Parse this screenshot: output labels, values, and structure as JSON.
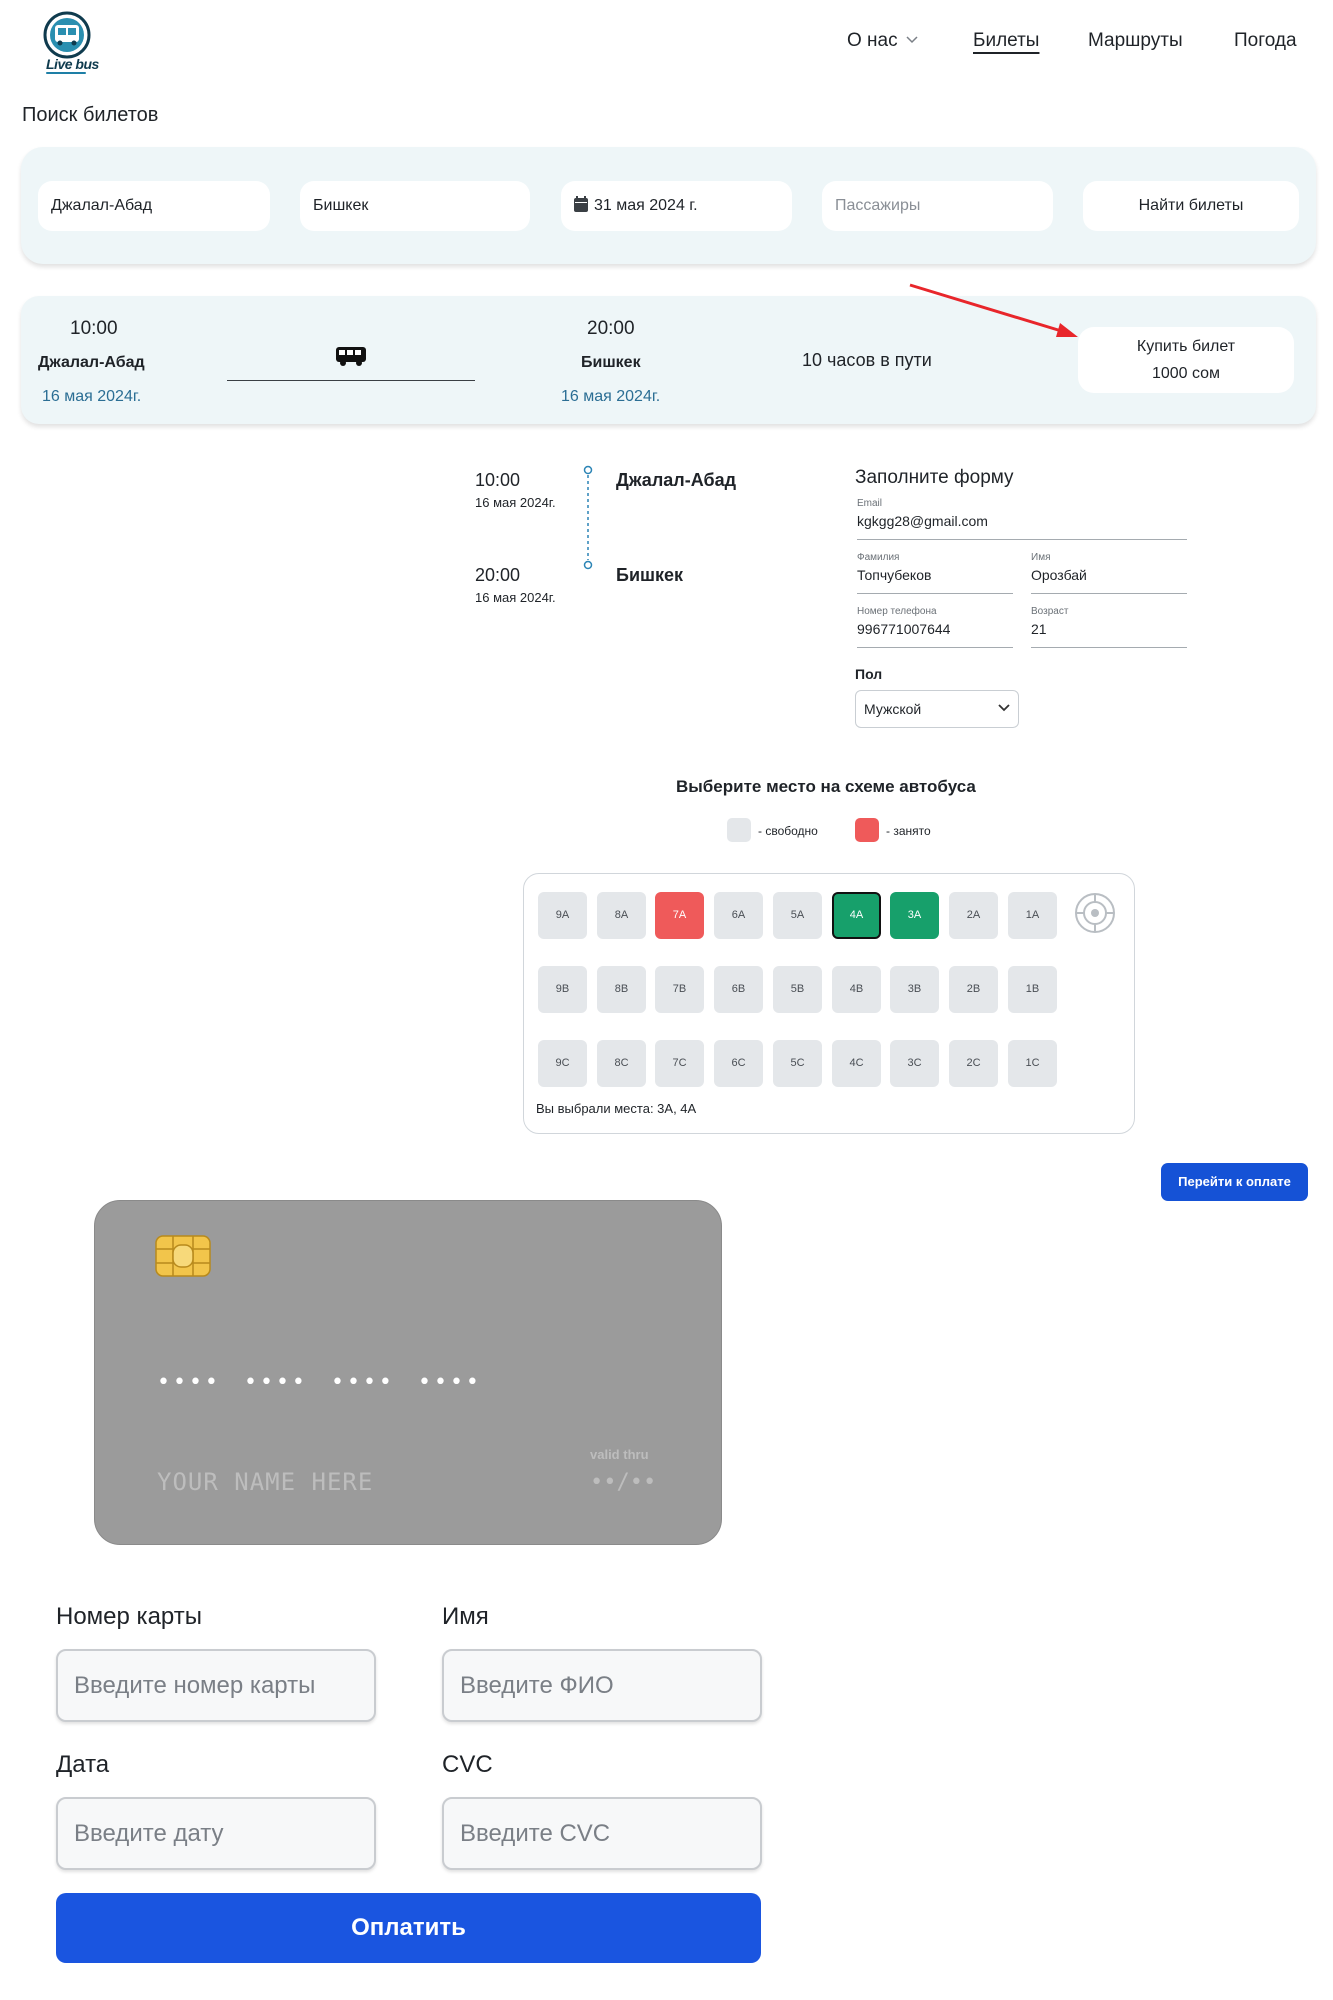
{
  "header": {
    "logo_text": "Live bus",
    "nav": [
      {
        "label": "О нас"
      },
      {
        "label": "Билеты"
      },
      {
        "label": "Маршруты"
      },
      {
        "label": "Погода"
      }
    ]
  },
  "page_title": "Поиск билетов",
  "search": {
    "from": "Джалал-Абад",
    "to": "Бишкек",
    "date": "31 мая 2024 г.",
    "passengers_placeholder": "Пассажиры",
    "button": "Найти билеты"
  },
  "result": {
    "depart_time": "10:00",
    "depart_city": "Джалал-Абад",
    "depart_date": "16 мая 2024г.",
    "arrive_time": "20:00",
    "arrive_city": "Бишкек",
    "arrive_date": "16 мая 2024г.",
    "duration": "10 часов в пути",
    "buy_label": "Купить билет",
    "price": "1000 сом"
  },
  "itinerary": {
    "depart_time": "10:00",
    "depart_date": "16 мая 2024г.",
    "depart_city": "Джалал-Абад",
    "arrive_time": "20:00",
    "arrive_date": "16 мая 2024г.",
    "arrive_city": "Бишкек"
  },
  "passenger_form": {
    "title": "Заполните форму",
    "email_label": "Email",
    "email": "kgkgg28@gmail.com",
    "surname_label": "Фамилия",
    "surname": "Топчубеков",
    "name_label": "Имя",
    "name": "Орозбай",
    "phone_label": "Номер телефона",
    "phone": "996771007644",
    "age_label": "Возраст",
    "age": "21",
    "gender_label": "Пол",
    "gender": "Мужской"
  },
  "seats": {
    "title": "Выберите место на схеме автобуса",
    "legend_free": "- свободно",
    "legend_taken": "- занято",
    "rows": [
      [
        {
          "id": "9A",
          "state": "free"
        },
        {
          "id": "8A",
          "state": "free"
        },
        {
          "id": "7A",
          "state": "taken"
        },
        {
          "id": "6A",
          "state": "free"
        },
        {
          "id": "5A",
          "state": "free"
        },
        {
          "id": "4A",
          "state": "chosen-current"
        },
        {
          "id": "3A",
          "state": "chosen"
        },
        {
          "id": "2A",
          "state": "free"
        },
        {
          "id": "1A",
          "state": "free"
        }
      ],
      [
        {
          "id": "9B",
          "state": "free"
        },
        {
          "id": "8B",
          "state": "free"
        },
        {
          "id": "7B",
          "state": "free"
        },
        {
          "id": "6B",
          "state": "free"
        },
        {
          "id": "5B",
          "state": "free"
        },
        {
          "id": "4B",
          "state": "free"
        },
        {
          "id": "3B",
          "state": "free"
        },
        {
          "id": "2B",
          "state": "free"
        },
        {
          "id": "1B",
          "state": "free"
        }
      ],
      [
        {
          "id": "9C",
          "state": "free"
        },
        {
          "id": "8C",
          "state": "free"
        },
        {
          "id": "7C",
          "state": "free"
        },
        {
          "id": "6C",
          "state": "free"
        },
        {
          "id": "5C",
          "state": "free"
        },
        {
          "id": "4C",
          "state": "free"
        },
        {
          "id": "3C",
          "state": "free"
        },
        {
          "id": "2C",
          "state": "free"
        },
        {
          "id": "1C",
          "state": "free"
        }
      ]
    ],
    "selected_text": "Вы выбрали места: 3A, 4A",
    "colors": {
      "free": "#e4e7ea",
      "taken": "#ef5a5a",
      "chosen": "#17a06b"
    }
  },
  "go_to_payment": "Перейти к оплате",
  "card_preview": {
    "number_mask": [
      "••••",
      "••••",
      "••••",
      "••••"
    ],
    "name": "YOUR NAME HERE",
    "valid_label": "valid thru",
    "valid_mask": "••/••"
  },
  "payment_form": {
    "card_number_label": "Номер карты",
    "card_number_placeholder": "Введите номер карты",
    "name_label": "Имя",
    "name_placeholder": "Введите ФИО",
    "date_label": "Дата",
    "date_placeholder": "Введите дату",
    "cvc_label": "CVC",
    "cvc_placeholder": "Введите CVC",
    "pay_button": "Оплатить"
  }
}
